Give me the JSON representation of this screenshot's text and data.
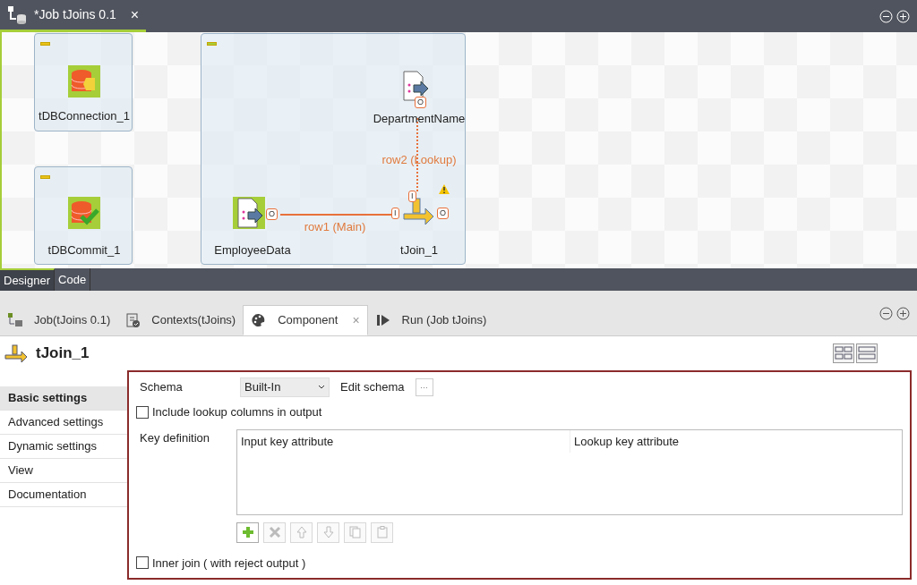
{
  "editor_tab": {
    "title": "*Job tJoins 0.1",
    "close": "×"
  },
  "canvas": {
    "subjobs": [
      {
        "kind": "single"
      },
      {
        "kind": "single"
      },
      {
        "kind": "group"
      }
    ],
    "nodes": [
      {
        "label": "tDBConnection_1",
        "kind": "db-connection",
        "warning": false
      },
      {
        "label": "tDBCommit_1",
        "kind": "db-commit",
        "warning": false
      },
      {
        "label": "EmployeeData",
        "kind": "file-input",
        "warning": false,
        "ports": [
          "O"
        ]
      },
      {
        "label": "DepartmentName",
        "kind": "file-input",
        "warning": false,
        "ports": [
          "O"
        ]
      },
      {
        "label": "tJoin_1",
        "kind": "join",
        "warning": true,
        "ports": [
          "I",
          "I",
          "O"
        ]
      }
    ],
    "links": [
      {
        "label": "row1 (Main)",
        "kind": "main"
      },
      {
        "label": "row2 (Lookup)",
        "kind": "lookup"
      }
    ]
  },
  "view_tabs": [
    {
      "label": "Designer",
      "selected": true
    },
    {
      "label": "Code",
      "selected": false
    }
  ],
  "panel_tabs": [
    {
      "label": "Job(tJoins 0.1)",
      "kind": "job",
      "selected": false
    },
    {
      "label": "Contexts(tJoins)",
      "kind": "contexts",
      "selected": false
    },
    {
      "label": "Component",
      "kind": "component",
      "selected": true,
      "close": "×"
    },
    {
      "label": "Run (Job tJoins)",
      "kind": "run",
      "selected": false
    }
  ],
  "component_title": "tJoin_1",
  "sidebar": {
    "items": [
      {
        "label": "Basic settings",
        "selected": true
      },
      {
        "label": "Advanced settings",
        "selected": false
      },
      {
        "label": "Dynamic settings",
        "selected": false
      },
      {
        "label": "View",
        "selected": false
      },
      {
        "label": "Documentation",
        "selected": false
      }
    ]
  },
  "form": {
    "schema_label": "Schema",
    "schema_value": "Built-In",
    "edit_schema_label": "Edit schema",
    "edit_schema_button": "···",
    "include_lookup": {
      "label": "Include lookup columns in output",
      "checked": false
    },
    "key_definition_label": "Key definition",
    "key_table": {
      "columns": [
        "Input key attribute",
        "Lookup key attribute"
      ]
    },
    "toolbar": [
      {
        "kind": "add",
        "disabled": false
      },
      {
        "kind": "delete",
        "disabled": true
      },
      {
        "kind": "up",
        "disabled": true
      },
      {
        "kind": "down",
        "disabled": true
      },
      {
        "kind": "copy",
        "disabled": true
      },
      {
        "kind": "paste",
        "disabled": true
      }
    ],
    "inner_join": {
      "label": "Inner join ( with reject output )",
      "checked": false
    }
  }
}
